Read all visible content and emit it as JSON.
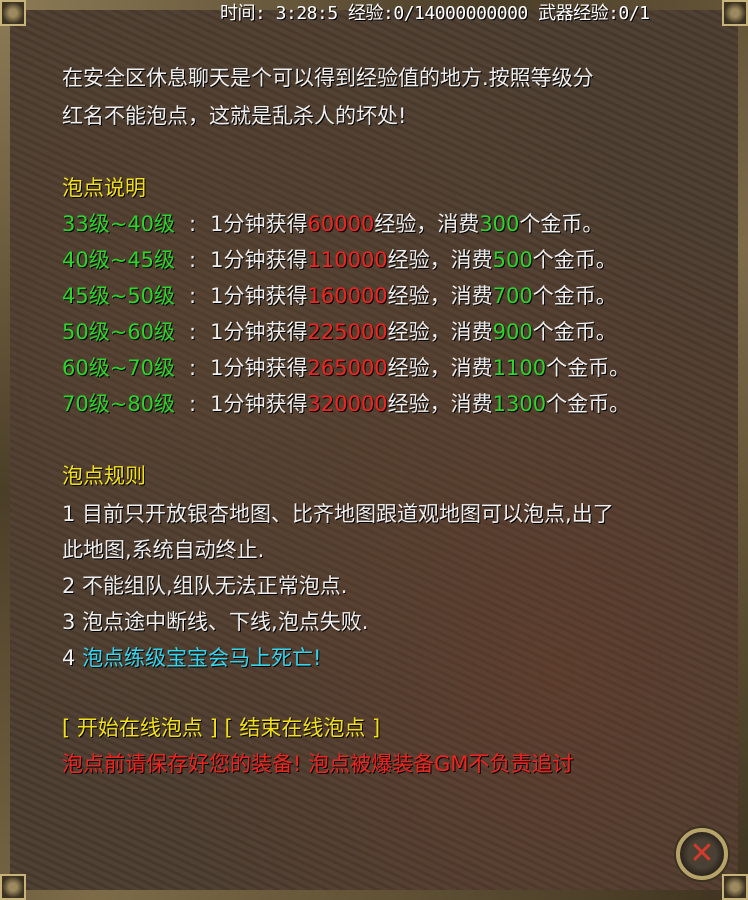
{
  "status": {
    "text": "时间: 3:28:5 经验:0/14000000000 武器经验:0/1"
  },
  "intro": {
    "line1": "在安全区休息聊天是个可以得到经验值的地方.按照等级分",
    "line2": "红名不能泡点，这就是乱杀人的坏处!"
  },
  "explain": {
    "title": "泡点说明",
    "sep": ":",
    "text_a": "1分钟获得",
    "text_b": "经验，消费",
    "text_c": "个金币。",
    "rows": [
      {
        "level": "33级~40级",
        "exp": "60000",
        "gold": "300"
      },
      {
        "level": "40级~45级",
        "exp": "110000",
        "gold": "500"
      },
      {
        "level": "45级~50级",
        "exp": "160000",
        "gold": "700"
      },
      {
        "level": "50级~60级",
        "exp": "225000",
        "gold": "900"
      },
      {
        "level": "60级~70级",
        "exp": "265000",
        "gold": "1100"
      },
      {
        "level": "70级~80级",
        "exp": "320000",
        "gold": "1300"
      }
    ]
  },
  "rules": {
    "title": "泡点规则",
    "r1a": "1 目前只开放银杏地图、比齐地图跟道观地图可以泡点,出了",
    "r1b": "此地图,系统自动终止.",
    "r2": "2 不能组队,组队无法正常泡点.",
    "r3": "3 泡点途中断线、下线,泡点失败.",
    "r4_num": "4",
    "r4_text": "泡点练级宝宝会马上死亡!"
  },
  "actions": {
    "open": "[",
    "start": "开始在线泡点",
    "mid": "] [",
    "stop": "结束在线泡点",
    "close": "]"
  },
  "warning": "泡点前请保存好您的装备! 泡点被爆装备GM不负责追讨",
  "colors": {
    "heading": "#f2e01d",
    "level": "#2bd52b",
    "exp_value": "#f2231f",
    "gold_value": "#2bd52b",
    "warning": "#f2231f",
    "highlight": "#34d6ef"
  },
  "icons": {
    "close": "close-x-icon"
  }
}
